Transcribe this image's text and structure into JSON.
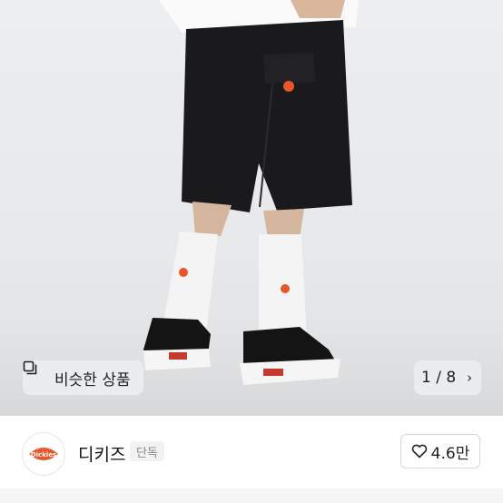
{
  "gallery": {
    "similar_label": "비슷한 상품",
    "counter": "1 / 8"
  },
  "store": {
    "name": "디키즈",
    "tag": "단독",
    "likes": "4.6만",
    "logo_text": "Dickies"
  },
  "colors": {
    "accent": "#e8562a"
  }
}
